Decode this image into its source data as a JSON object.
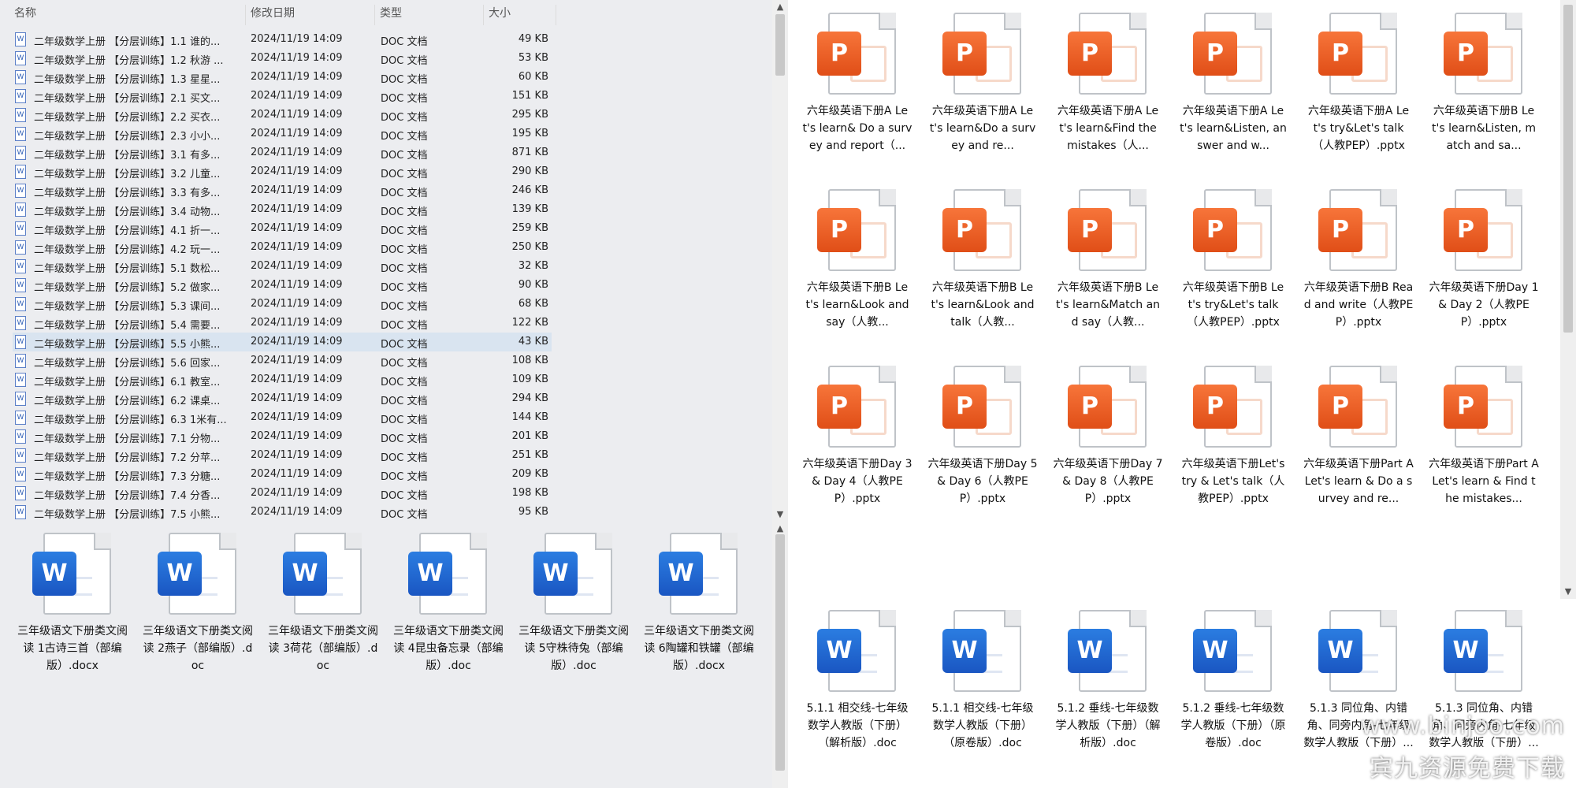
{
  "details": {
    "columns": [
      "名称",
      "修改日期",
      "类型",
      "大小"
    ],
    "rows": [
      {
        "name": "二年级数学上册  【分层训练】1.1 谁的...",
        "date": "2024/11/19 14:09",
        "type": "DOC 文档",
        "size": "49 KB"
      },
      {
        "name": "二年级数学上册  【分层训练】1.2 秋游 ...",
        "date": "2024/11/19 14:09",
        "type": "DOC 文档",
        "size": "53 KB"
      },
      {
        "name": "二年级数学上册  【分层训练】1.3 星星...",
        "date": "2024/11/19 14:09",
        "type": "DOC 文档",
        "size": "60 KB"
      },
      {
        "name": "二年级数学上册  【分层训练】2.1 买文...",
        "date": "2024/11/19 14:09",
        "type": "DOC 文档",
        "size": "151 KB"
      },
      {
        "name": "二年级数学上册  【分层训练】2.2 买衣...",
        "date": "2024/11/19 14:09",
        "type": "DOC 文档",
        "size": "295 KB"
      },
      {
        "name": "二年级数学上册  【分层训练】2.3 小小...",
        "date": "2024/11/19 14:09",
        "type": "DOC 文档",
        "size": "195 KB"
      },
      {
        "name": "二年级数学上册  【分层训练】3.1 有多...",
        "date": "2024/11/19 14:09",
        "type": "DOC 文档",
        "size": "871 KB"
      },
      {
        "name": "二年级数学上册  【分层训练】3.2 儿童...",
        "date": "2024/11/19 14:09",
        "type": "DOC 文档",
        "size": "290 KB"
      },
      {
        "name": "二年级数学上册  【分层训练】3.3 有多...",
        "date": "2024/11/19 14:09",
        "type": "DOC 文档",
        "size": "246 KB"
      },
      {
        "name": "二年级数学上册  【分层训练】3.4 动物...",
        "date": "2024/11/19 14:09",
        "type": "DOC 文档",
        "size": "139 KB"
      },
      {
        "name": "二年级数学上册  【分层训练】4.1 折一...",
        "date": "2024/11/19 14:09",
        "type": "DOC 文档",
        "size": "259 KB"
      },
      {
        "name": "二年级数学上册  【分层训练】4.2 玩一...",
        "date": "2024/11/19 14:09",
        "type": "DOC 文档",
        "size": "250 KB"
      },
      {
        "name": "二年级数学上册  【分层训练】5.1 数松...",
        "date": "2024/11/19 14:09",
        "type": "DOC 文档",
        "size": "32 KB"
      },
      {
        "name": "二年级数学上册  【分层训练】5.2 做家...",
        "date": "2024/11/19 14:09",
        "type": "DOC 文档",
        "size": "90 KB"
      },
      {
        "name": "二年级数学上册  【分层训练】5.3 课间...",
        "date": "2024/11/19 14:09",
        "type": "DOC 文档",
        "size": "68 KB"
      },
      {
        "name": "二年级数学上册  【分层训练】5.4 需要...",
        "date": "2024/11/19 14:09",
        "type": "DOC 文档",
        "size": "122 KB"
      },
      {
        "name": "二年级数学上册  【分层训练】5.5 小熊...",
        "date": "2024/11/19 14:09",
        "type": "DOC 文档",
        "size": "43 KB"
      },
      {
        "name": "二年级数学上册  【分层训练】5.6 回家...",
        "date": "2024/11/19 14:09",
        "type": "DOC 文档",
        "size": "108 KB"
      },
      {
        "name": "二年级数学上册  【分层训练】6.1 教室...",
        "date": "2024/11/19 14:09",
        "type": "DOC 文档",
        "size": "109 KB"
      },
      {
        "name": "二年级数学上册  【分层训练】6.2 课桌...",
        "date": "2024/11/19 14:09",
        "type": "DOC 文档",
        "size": "294 KB"
      },
      {
        "name": "二年级数学上册  【分层训练】6.3 1米有...",
        "date": "2024/11/19 14:09",
        "type": "DOC 文档",
        "size": "144 KB"
      },
      {
        "name": "二年级数学上册  【分层训练】7.1 分物...",
        "date": "2024/11/19 14:09",
        "type": "DOC 文档",
        "size": "201 KB"
      },
      {
        "name": "二年级数学上册  【分层训练】7.2 分苹...",
        "date": "2024/11/19 14:09",
        "type": "DOC 文档",
        "size": "251 KB"
      },
      {
        "name": "二年级数学上册  【分层训练】7.3 分糖...",
        "date": "2024/11/19 14:09",
        "type": "DOC 文档",
        "size": "209 KB"
      },
      {
        "name": "二年级数学上册  【分层训练】7.4 分香...",
        "date": "2024/11/19 14:09",
        "type": "DOC 文档",
        "size": "198 KB"
      },
      {
        "name": "二年级数学上册  【分层训练】7.5 小熊...",
        "date": "2024/11/19 14:09",
        "type": "DOC 文档",
        "size": "95 KB"
      }
    ],
    "selected_index": 16,
    "file_icon_glyph": "W"
  },
  "bottom_left": {
    "badge_letter": "W",
    "tiles": [
      {
        "label": "三年级语文下册类文阅读 1古诗三首（部编版）.docx"
      },
      {
        "label": "三年级语文下册类文阅读 2燕子（部编版）.doc"
      },
      {
        "label": "三年级语文下册类文阅读 3荷花（部编版）.doc"
      },
      {
        "label": "三年级语文下册类文阅读 4昆虫备忘录（部编版）.doc"
      },
      {
        "label": "三年级语文下册类文阅读 5守株待兔（部编版）.doc"
      },
      {
        "label": "三年级语文下册类文阅读 6陶罐和铁罐（部编版）.docx"
      }
    ]
  },
  "top_right": {
    "badge_letter": "P",
    "tiles": [
      {
        "label": "六年级英语下册A Let's learn& Do a survey and report（..."
      },
      {
        "label": "六年级英语下册A Let's learn&Do a survey and re..."
      },
      {
        "label": "六年级英语下册A Let's learn&Find the mistakes（人..."
      },
      {
        "label": "六年级英语下册A Let's learn&Listen, answer and w..."
      },
      {
        "label": "六年级英语下册A Let's try&Let's talk（人教PEP）.pptx"
      },
      {
        "label": "六年级英语下册B Let's learn&Listen, match and sa..."
      },
      {
        "label": "六年级英语下册B Let's learn&Look and say（人教..."
      },
      {
        "label": "六年级英语下册B Let's learn&Look and talk（人教..."
      },
      {
        "label": "六年级英语下册B Let's learn&Match and say（人教..."
      },
      {
        "label": "六年级英语下册B Let's try&Let's talk（人教PEP）.pptx"
      },
      {
        "label": "六年级英语下册B Read and write（人教PEP）.pptx"
      },
      {
        "label": "六年级英语下册Day 1 & Day 2（人教PEP）.pptx"
      },
      {
        "label": "六年级英语下册Day 3 & Day 4（人教PEP）.pptx"
      },
      {
        "label": "六年级英语下册Day 5 & Day 6（人教PEP）.pptx"
      },
      {
        "label": "六年级英语下册Day 7 & Day 8（人教PEP）.pptx"
      },
      {
        "label": "六年级英语下册Let's try & Let's talk（人教PEP）.pptx"
      },
      {
        "label": "六年级英语下册Part A Let's learn & Do a survey and re..."
      },
      {
        "label": "六年级英语下册Part A Let's learn & Find the mistakes..."
      }
    ]
  },
  "bottom_right": {
    "badge_letter": "W",
    "tiles": [
      {
        "label": "5.1.1 相交线-七年级数学人教版（下册）（解析版）.doc"
      },
      {
        "label": "5.1.1 相交线-七年级数学人教版（下册）（原卷版）.doc"
      },
      {
        "label": "5.1.2 垂线-七年级数学人教版（下册）（解析版）.doc"
      },
      {
        "label": "5.1.2 垂线-七年级数学人教版（下册）（原卷版）.doc"
      },
      {
        "label": "5.1.3 同位角、内错角、同旁内角-七年级数学人教版（下册）..."
      },
      {
        "label": "5.1.3 同位角、内错角、同旁内角-七年级数学人教版（下册）..."
      }
    ]
  },
  "watermark": {
    "line1": "www.binjoo.com",
    "line2": "宾九资源免费下载"
  },
  "colors": {
    "word_blue": "#1a56c2",
    "ppt_orange": "#e04e17",
    "selection": "#d9e4f0"
  }
}
